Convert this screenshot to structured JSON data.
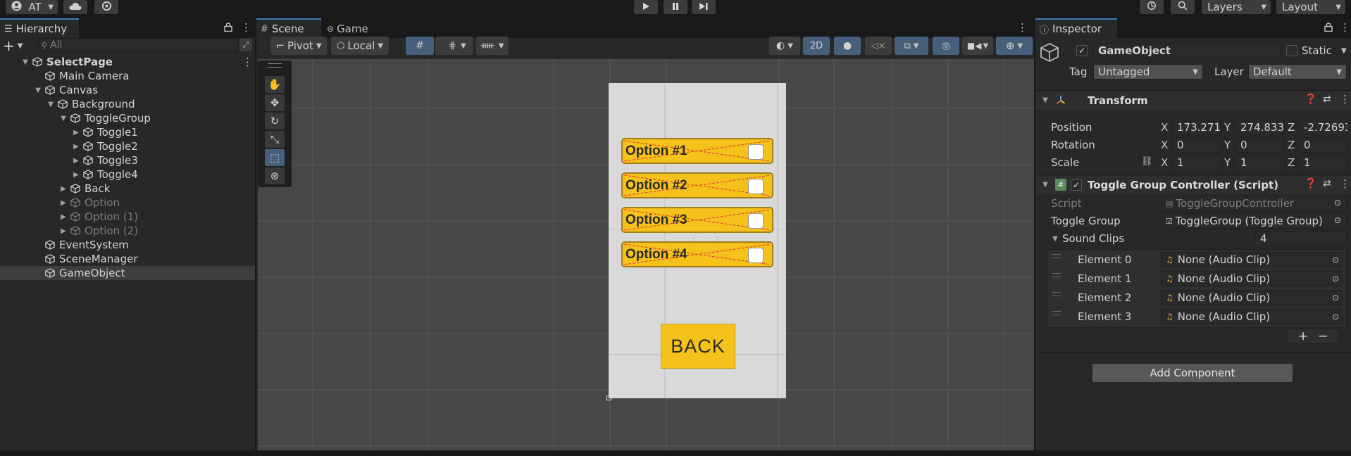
{
  "topbar": {
    "account_label": "AT",
    "history_icon": "history-icon",
    "search_icon": "search-icon",
    "layers_label": "Layers",
    "layout_label": "Layout",
    "play_icon": "play-icon",
    "pause_icon": "pause-icon",
    "step_icon": "step-icon"
  },
  "hierarchy": {
    "tab_label": "Hierarchy",
    "search_placeholder": "All",
    "add_label": "+",
    "items": [
      {
        "label": "SelectPage",
        "depth": 0,
        "fold": "open",
        "style": "scene"
      },
      {
        "label": "Main Camera",
        "depth": 1,
        "fold": "none",
        "style": "normal"
      },
      {
        "label": "Canvas",
        "depth": 1,
        "fold": "open",
        "style": "normal"
      },
      {
        "label": "Background",
        "depth": 2,
        "fold": "open",
        "style": "normal"
      },
      {
        "label": "ToggleGroup",
        "depth": 3,
        "fold": "open",
        "style": "normal"
      },
      {
        "label": "Toggle1",
        "depth": 4,
        "fold": "closed",
        "style": "normal"
      },
      {
        "label": "Toggle2",
        "depth": 4,
        "fold": "closed",
        "style": "normal"
      },
      {
        "label": "Toggle3",
        "depth": 4,
        "fold": "closed",
        "style": "normal"
      },
      {
        "label": "Toggle4",
        "depth": 4,
        "fold": "closed",
        "style": "normal"
      },
      {
        "label": "Back",
        "depth": 3,
        "fold": "closed",
        "style": "normal"
      },
      {
        "label": "Option",
        "depth": 3,
        "fold": "closed",
        "style": "dim"
      },
      {
        "label": "Option (1)",
        "depth": 3,
        "fold": "closed",
        "style": "dim"
      },
      {
        "label": "Option (2)",
        "depth": 3,
        "fold": "closed",
        "style": "dim"
      },
      {
        "label": "EventSystem",
        "depth": 1,
        "fold": "none",
        "style": "normal"
      },
      {
        "label": "SceneManager",
        "depth": 1,
        "fold": "none",
        "style": "normal"
      },
      {
        "label": "GameObject",
        "depth": 1,
        "fold": "none",
        "style": "selected"
      }
    ]
  },
  "scene": {
    "tab_scene": "Scene",
    "tab_game": "Game",
    "pivot_label": "Pivot",
    "local_label": "Local",
    "mode_2d": "2D",
    "options": [
      "Option #1",
      "Option #2",
      "Option #3",
      "Option #4"
    ],
    "back_label": "BACK"
  },
  "inspector": {
    "tab_label": "Inspector",
    "object_name": "GameObject",
    "static_label": "Static",
    "tag_label": "Tag",
    "tag_value": "Untagged",
    "layer_label": "Layer",
    "layer_value": "Default",
    "transform": {
      "title": "Transform",
      "position_label": "Position",
      "rotation_label": "Rotation",
      "scale_label": "Scale",
      "position": {
        "x": "173.271",
        "y": "274.833",
        "z": "-2.72693"
      },
      "rotation": {
        "x": "0",
        "y": "0",
        "z": "0"
      },
      "scale": {
        "x": "1",
        "y": "1",
        "z": "1"
      }
    },
    "script_component": {
      "title": "Toggle Group Controller (Script)",
      "script_label": "Script",
      "script_value": "ToggleGroupController",
      "toggle_group_label": "Toggle Group",
      "toggle_group_value": "ToggleGroup (Toggle Group)",
      "sound_clips_label": "Sound Clips",
      "sound_clips_count": "4",
      "elements": [
        {
          "label": "Element 0",
          "value": "None (Audio Clip)"
        },
        {
          "label": "Element 1",
          "value": "None (Audio Clip)"
        },
        {
          "label": "Element 2",
          "value": "None (Audio Clip)"
        },
        {
          "label": "Element 3",
          "value": "None (Audio Clip)"
        }
      ],
      "plus_label": "+",
      "minus_label": "−"
    },
    "add_component_label": "Add Component"
  },
  "colors": {
    "accent": "#3a79bb",
    "option_fill": "#f5c21b",
    "panel": "#282828",
    "background": "#191919"
  }
}
